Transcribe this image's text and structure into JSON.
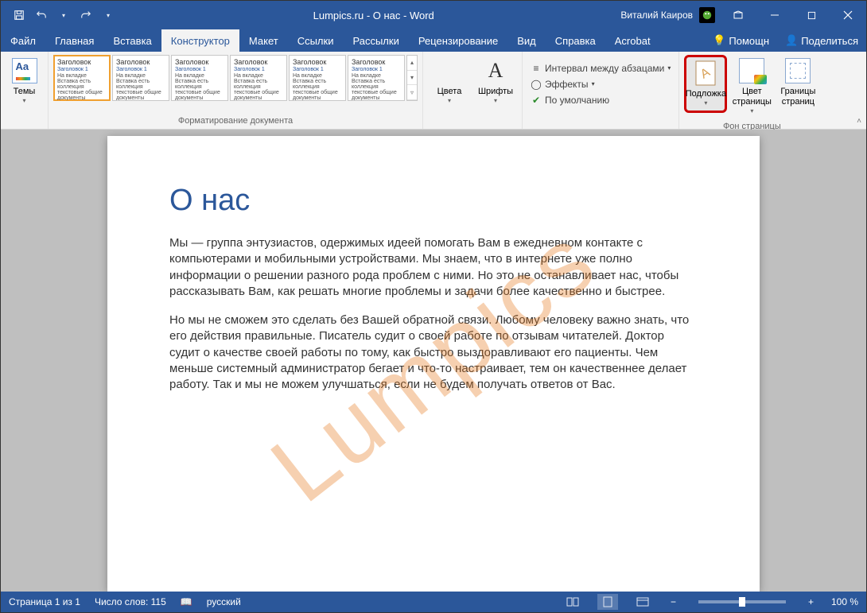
{
  "titlebar": {
    "title": "Lumpics.ru - О нас  -  Word",
    "username": "Виталий Каиров"
  },
  "tabs": {
    "file": "Файл",
    "home": "Главная",
    "insert": "Вставка",
    "design": "Конструктор",
    "layout": "Макет",
    "references": "Ссылки",
    "mailings": "Рассылки",
    "review": "Рецензирование",
    "view": "Вид",
    "help_tab": "Справка",
    "acrobat": "Acrobat",
    "help": "Помощн",
    "share": "Поделиться"
  },
  "ribbon": {
    "themes": "Темы",
    "formatting_group": "Форматирование документа",
    "colors": "Цвета",
    "fonts": "Шрифты",
    "paragraph_spacing": "Интервал между абзацами",
    "effects": "Эффекты",
    "set_default": "По умолчанию",
    "watermark": "Подложка",
    "page_color": "Цвет страницы",
    "page_borders": "Границы страниц",
    "page_background_group": "Фон страницы",
    "styletile_heading": "Заголовок",
    "styletile_heading1": "Заголовок 1",
    "styletile_lorem": "На вкладке Вставка есть коллекция текстовые общие документы"
  },
  "document": {
    "watermark_text": "Lumpics",
    "heading": "О нас",
    "p1": "Мы — группа энтузиастов, одержимых идеей помогать Вам в ежедневном контакте с компьютерами и мобильными устройствами. Мы знаем, что в интернете уже полно информации о решении разного рода проблем с ними. Но это не останавливает нас, чтобы рассказывать Вам, как решать многие проблемы и задачи более качественно и быстрее.",
    "p2": "Но мы не сможем это сделать без Вашей обратной связи. Любому человеку важно знать, что его действия правильные. Писатель судит о своей работе по отзывам читателей. Доктор судит о качестве своей работы по тому, как быстро выздоравливают его пациенты. Чем меньше системный администратор бегает и что-то настраивает, тем он качественнее делает работу. Так и мы не можем улучшаться, если не будем получать ответов от Вас."
  },
  "status": {
    "page": "Страница 1 из 1",
    "words": "Число слов: 115",
    "lang": "русский",
    "zoom": "100 %"
  }
}
